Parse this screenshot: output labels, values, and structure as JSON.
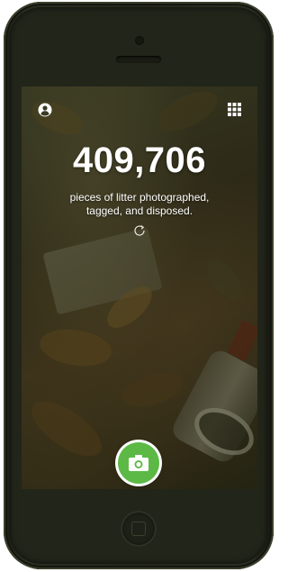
{
  "stats": {
    "count": "409,706",
    "caption_line1": "pieces of litter photographed,",
    "caption_line2": "tagged, and disposed."
  },
  "icons": {
    "profile": "user-icon",
    "menu": "grid-icon",
    "refresh": "refresh-icon",
    "camera": "camera-icon"
  },
  "colors": {
    "accent": "#5cb946",
    "text": "#ffffff"
  }
}
